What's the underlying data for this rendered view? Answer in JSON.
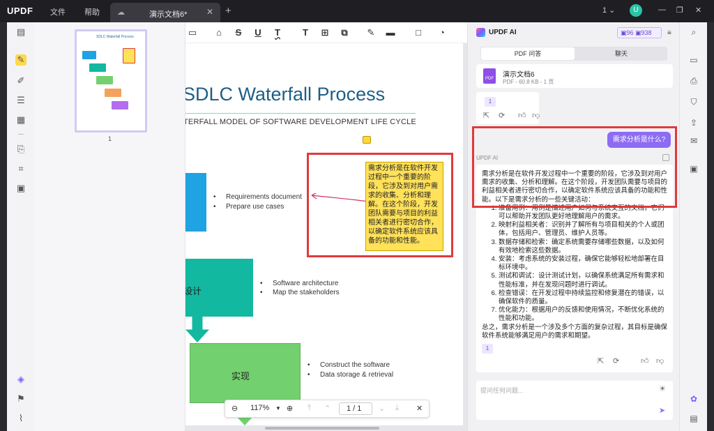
{
  "app": {
    "logo": "UPDF",
    "menu": [
      "文件",
      "帮助"
    ],
    "tab_title": "演示文档6*",
    "page_indicator": "1",
    "user_initial": "U"
  },
  "thumbnail": {
    "title": "SDLC Waterfall Process",
    "page_number": "1"
  },
  "document": {
    "title": "SDLC Waterfall Process",
    "subtitle": "TERFALL MODEL OF SOFTWARE DEVELOPMENT LIFE CYCLE",
    "stages": [
      {
        "label": "",
        "bullets": [
          "Requirements document",
          "Prepare use cases"
        ],
        "color": "#1fa3e2"
      },
      {
        "label": "设计",
        "bullets": [
          "Software architecture",
          "Map the stakeholders"
        ],
        "color": "#13b8a0"
      },
      {
        "label": "实现",
        "bullets": [
          "Construct the software",
          "Data storage & retrieval"
        ],
        "color": "#72d16e"
      }
    ],
    "sticky_note": "需求分析是在软件开发过程中一个重要的阶段，它涉及到对用户需求的收集、分析和理解。在这个阶段，开发团队需要与项目的利益相关者进行密切合作，以确定软件系统应该具备的功能和性能。"
  },
  "zoombar": {
    "zoom": "117%",
    "page": "1 / 1"
  },
  "ai": {
    "title": "UPDF AI",
    "credit_a": "96",
    "credit_b": "938",
    "tabs": [
      "PDF 问答",
      "聊天"
    ],
    "file_name": "演示文档6",
    "file_meta": "PDF - 60.8 KB - 1 页",
    "badge": "1",
    "user_question": "需求分析是什么?",
    "ai_label": "UPDF AI",
    "answer_intro": "需求分析是在软件开发过程中一个重要的阶段，它涉及到对用户需求的收集、分析和理解。在这个阶段，开发团队需要与项目的利益相关者进行密切合作，以确定软件系统应该具备的功能和性能。以下是需求分析的一些关键活动：",
    "answer_items": [
      "准备用例：用例是描述用户如何与系统交互的文档，它们可以帮助开发团队更好地理解用户的需求。",
      "映射利益相关者：识别并了解所有与项目相关的个人或团体，包括用户、管理员、维护人员等。",
      "数据存储和检索：确定系统需要存储哪些数据，以及如何有效地检索这些数据。",
      "安装：考虑系统的安装过程，确保它能够轻松地部署在目标环境中。",
      "测试和调试：设计测试计划，以确保系统满足所有需求和性能标准，并在发现问题时进行调试。",
      "检查错误：在开发过程中持续监控和修复潜在的错误，以确保软件的质量。",
      "优化能力：根据用户的反馈和使用情况，不断优化系统的性能和功能。"
    ],
    "answer_summary": "总之，需求分析是一个涉及多个方面的复杂过程，其目标是确保软件系统能够满足用户的需求和期望。",
    "input_placeholder": "提问任何问题..."
  },
  "colors": {
    "accent": "#8d6cf4",
    "highlight_red": "#e03a3a",
    "sticky": "#ffe15a"
  }
}
